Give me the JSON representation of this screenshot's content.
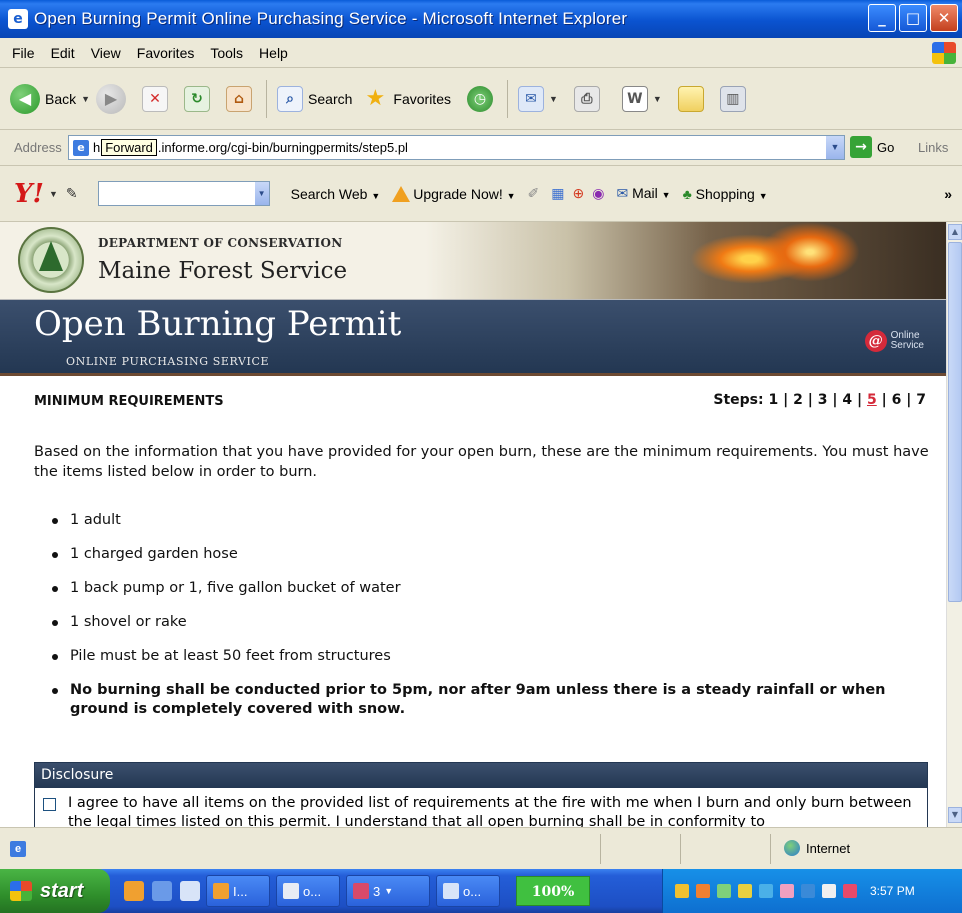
{
  "window": {
    "title": "Open Burning Permit Online Purchasing Service - Microsoft Internet Explorer"
  },
  "menu": [
    "File",
    "Edit",
    "View",
    "Favorites",
    "Tools",
    "Help"
  ],
  "toolbar": {
    "back_label": "Back",
    "search_label": "Search",
    "favorites_label": "Favorites"
  },
  "address": {
    "label": "Address",
    "url_prefix": "h",
    "tooltip": "Forward",
    "url_rest": ".informe.org/cgi-bin/burningpermits/step5.pl",
    "go_label": "Go",
    "links_label": "Links"
  },
  "yahoo_toolbar": {
    "logo": "Y!",
    "search_web": "Search Web",
    "upgrade": "Upgrade Now!",
    "mail": "Mail",
    "shopping": "Shopping"
  },
  "site": {
    "department": "DEPARTMENT OF CONSERVATION",
    "service": "Maine Forest Service",
    "banner_title": "Open Burning Permit",
    "banner_subtitle": "ONLINE PURCHASING SERVICE",
    "online_service_line1": "Online",
    "online_service_line2": "Service"
  },
  "page": {
    "section_heading": "MINIMUM REQUIREMENTS",
    "steps_label": "Steps:",
    "steps": [
      "1",
      "2",
      "3",
      "4",
      "5",
      "6",
      "7"
    ],
    "current_step": "5",
    "intro": "Based on the information that you have provided for your open burn, these are the minimum requirements. You must have the items listed below in order to burn.",
    "requirements": [
      "1 adult",
      "1 charged garden hose",
      "1 back pump or 1, five gallon bucket of water",
      "1 shovel or rake",
      "Pile must be at least 50 feet from structures",
      "No burning shall be conducted prior to 5pm, nor after 9am unless there is a steady rainfall or when ground is completely covered with snow."
    ],
    "disclosure_heading": "Disclosure",
    "disclosure_text": "I agree to have all items on the provided list of requirements at the fire with me when I burn and only burn between the legal times listed on this permit. I understand that all open burning shall be in conformity to"
  },
  "status": {
    "zone": "Internet"
  },
  "taskbar": {
    "start": "start",
    "tasks": [
      "I...",
      "o...",
      "3",
      "o..."
    ],
    "zoom": "100%",
    "clock": "3:57 PM"
  }
}
